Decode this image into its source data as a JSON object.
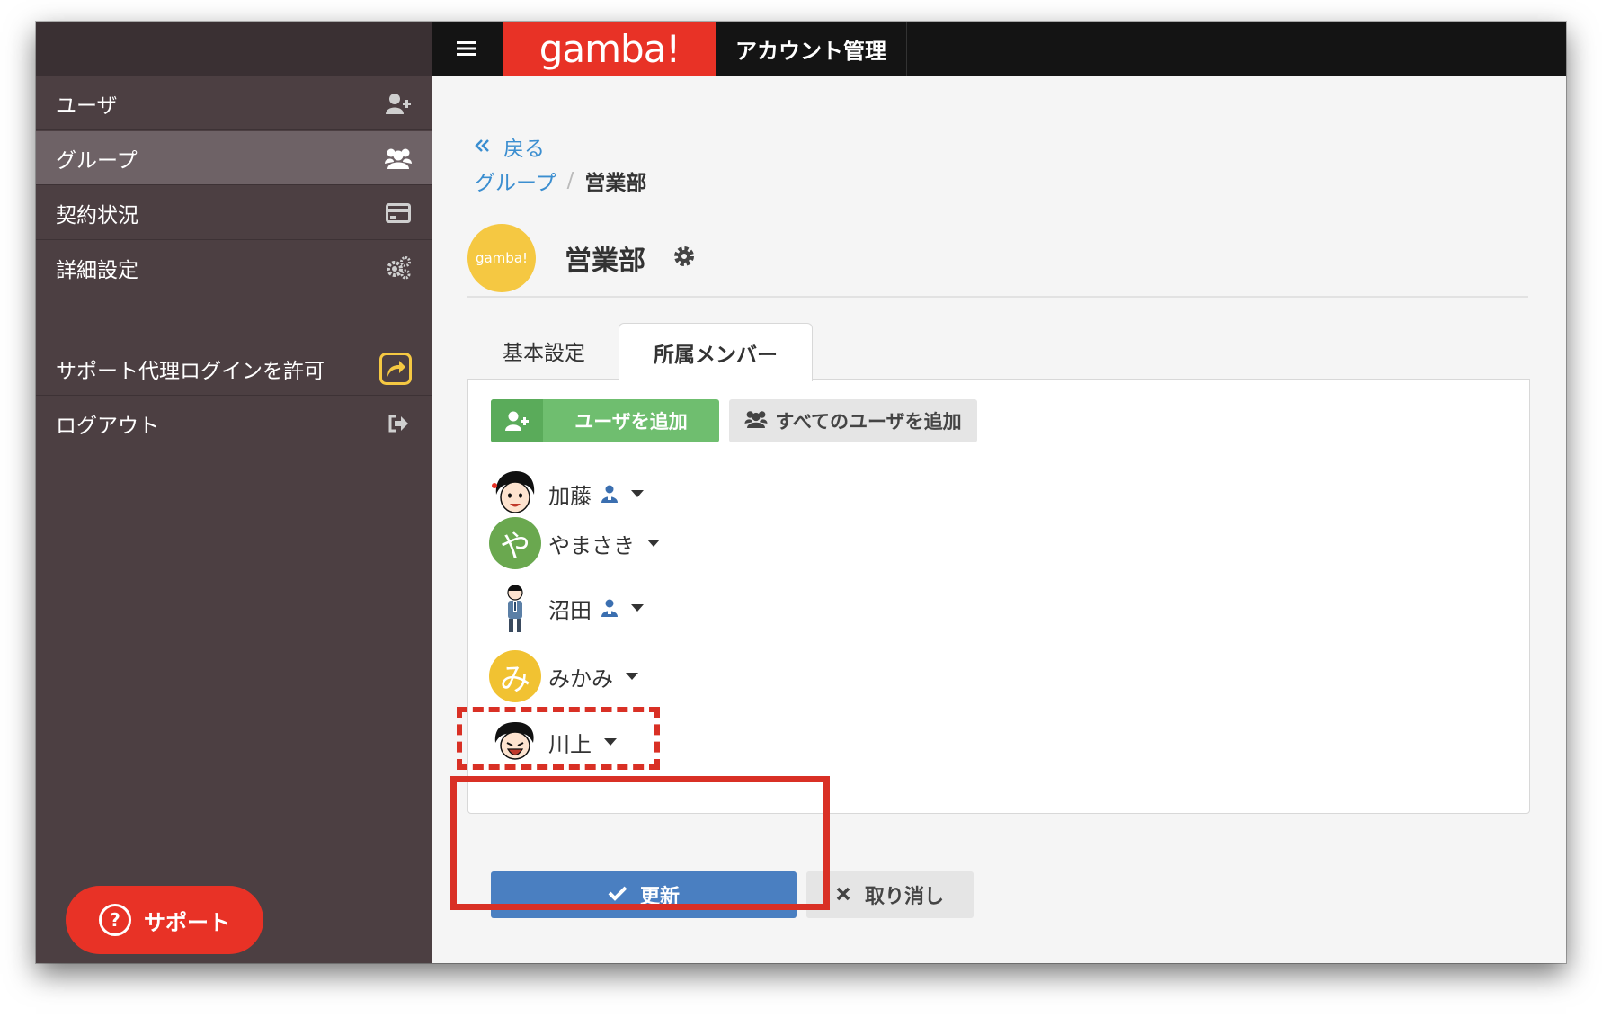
{
  "topbar": {
    "logo": "gamba!",
    "title": "アカウント管理",
    "menu_icon": "hamburger-icon"
  },
  "sidebar": {
    "items": [
      {
        "label": "ユーザ",
        "icon": "user-add-icon"
      },
      {
        "label": "グループ",
        "icon": "users-icon",
        "active": true
      },
      {
        "label": "契約状況",
        "icon": "credit-card-icon"
      },
      {
        "label": "詳細設定",
        "icon": "gears-icon"
      },
      {
        "label": "サポート代理ログインを許可",
        "icon": "share-icon"
      },
      {
        "label": "ログアウト",
        "icon": "sign-out-icon"
      }
    ],
    "support_label": "サポート"
  },
  "main": {
    "back": "戻る",
    "breadcrumb": {
      "parent": "グループ",
      "separator": "/",
      "current": "営業部"
    },
    "group": {
      "avatar_text": "gamba!",
      "name": "営業部"
    },
    "tabs": [
      {
        "label": "基本設定"
      },
      {
        "label": "所属メンバー",
        "active": true
      }
    ],
    "add_user_label": "ユーザを追加",
    "add_all_label": "すべてのユーザを追加",
    "members": [
      {
        "name": "加藤",
        "admin": true
      },
      {
        "name": "やまさき",
        "letter": "や",
        "color": "#6aa84f"
      },
      {
        "name": "沼田",
        "admin": true
      },
      {
        "name": "みかみ",
        "letter": "み",
        "color": "#f1c232"
      },
      {
        "name": "川上"
      }
    ],
    "update_label": "更新",
    "cancel_label": "取り消し"
  },
  "colors": {
    "brand": "#e83226",
    "primary": "#4a7fc1",
    "success": "#6fbe6f",
    "sidebar": "#4c3f42",
    "highlight": "#d93025"
  }
}
